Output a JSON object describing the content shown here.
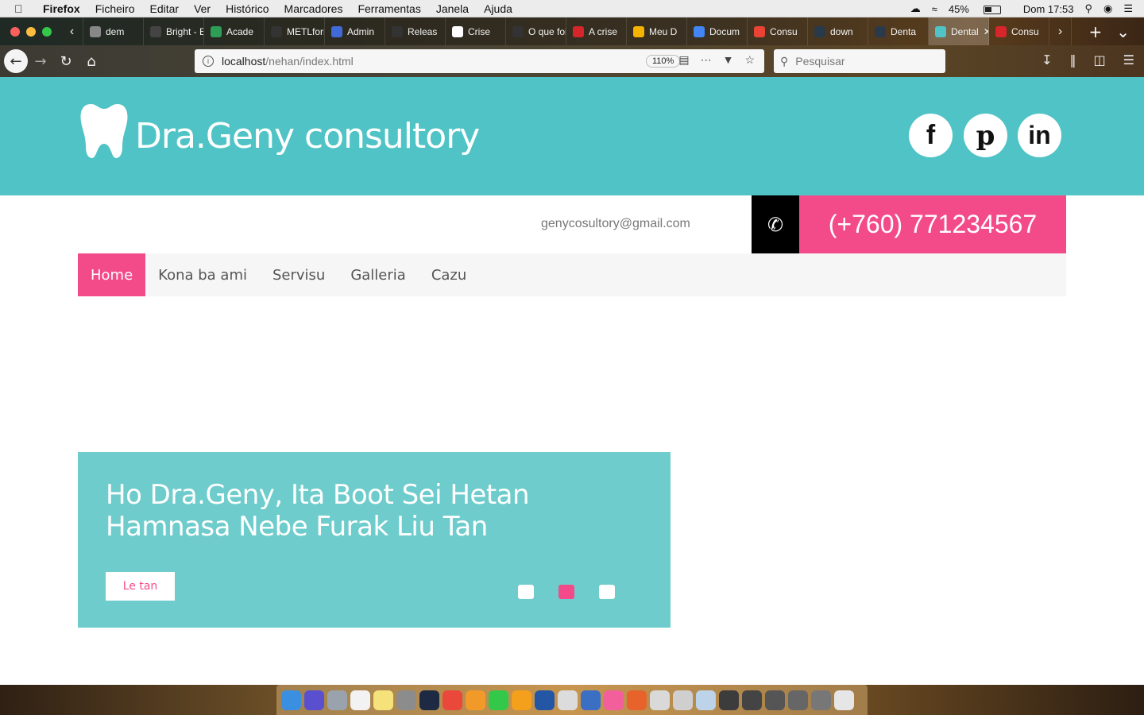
{
  "menubar": {
    "app": "Firefox",
    "items": [
      "Ficheiro",
      "Editar",
      "Ver",
      "Histórico",
      "Marcadores",
      "Ferramentas",
      "Janela",
      "Ajuda"
    ],
    "battery": "45%",
    "clock": "Dom 17:53"
  },
  "tabs": [
    {
      "label": "dem",
      "color": "#888888"
    },
    {
      "label": "Bright - Ed",
      "color": "#444444"
    },
    {
      "label": "Acade",
      "color": "#2e9e56"
    },
    {
      "label": "METLform",
      "color": "#333333"
    },
    {
      "label": "Admin",
      "color": "#3f6ad8"
    },
    {
      "label": "Releas",
      "color": "#333333"
    },
    {
      "label": "Crise",
      "color": "#ffffff"
    },
    {
      "label": "O que foi",
      "color": "#333333"
    },
    {
      "label": "A crise",
      "color": "#d7262b"
    },
    {
      "label": "Meu D",
      "color": "#f4b400"
    },
    {
      "label": "Docum",
      "color": "#4285f4"
    },
    {
      "label": "Consu",
      "color": "#ea4335"
    },
    {
      "label": "down",
      "color": "#2b3a4a"
    },
    {
      "label": "Denta",
      "color": "#2b3a4a"
    },
    {
      "label": "Dental",
      "color": "#4fc3c5",
      "active": true
    },
    {
      "label": "Consu",
      "color": "#d7262b"
    }
  ],
  "toolbar": {
    "url_host": "localhost",
    "url_path": "/nehan/index.html",
    "zoom": "110%",
    "search_placeholder": "Pesquisar"
  },
  "site": {
    "brand": "Dra.Geny consultory",
    "email": "genycosultory@gmail.com",
    "phone": "(+760) 771234567",
    "social": [
      {
        "name": "facebook",
        "glyph": "f"
      },
      {
        "name": "pinterest",
        "glyph": "p"
      },
      {
        "name": "linkedin",
        "glyph": "in"
      }
    ],
    "nav": [
      "Home",
      "Kona ba ami",
      "Servisu",
      "Galleria",
      "Cazu"
    ],
    "hero": {
      "title": "Ho Dra.Geny, Ita Boot Sei Hetan Hamnasa Nebe Furak Liu Tan",
      "cta": "Le tan",
      "slides": 3,
      "active_slide": 2
    }
  },
  "colors": {
    "header": "#4fc3c5",
    "accent": "#f34b8a",
    "hero_bg": "#6fcccc"
  }
}
